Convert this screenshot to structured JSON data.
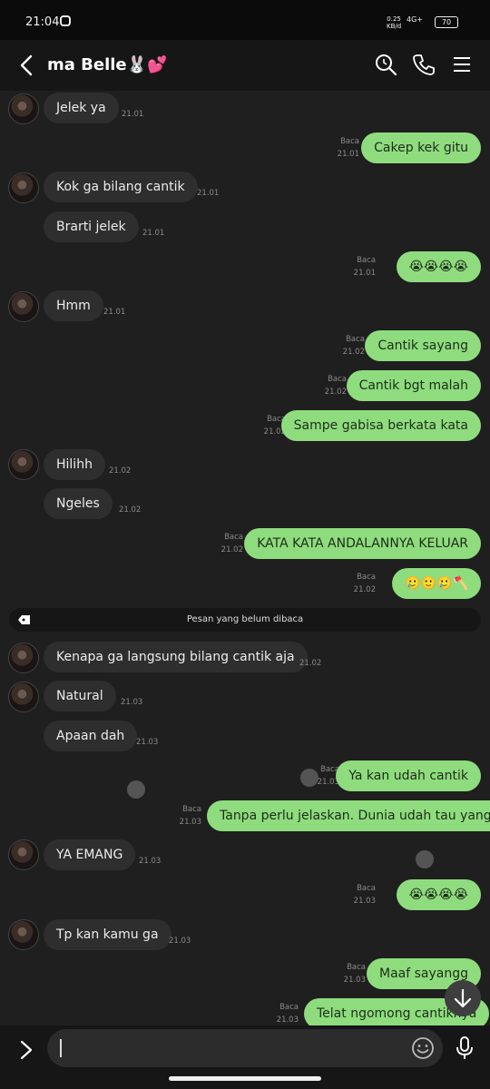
{
  "status_bar": {
    "time": "21:04",
    "net_speed": "0.25\nKB/d",
    "network": "4G+",
    "battery": "70"
  },
  "header": {
    "title": "ma Belle🐰💕",
    "back_icon": "chevron-left-icon",
    "search_icon": "search-icon",
    "call_icon": "phone-icon",
    "menu_icon": "menu-icon"
  },
  "messages": [
    {
      "dir": "in",
      "avatar": true,
      "text": "Jelek ya",
      "time": "21.01"
    },
    {
      "dir": "out",
      "text": "Cakep kek gitu",
      "read": "Baca",
      "time": "21.01"
    },
    {
      "dir": "in",
      "avatar": true,
      "text": "Kok ga bilang cantik",
      "time": "21.01"
    },
    {
      "dir": "in",
      "text": "Brarti jelek",
      "time": "21.01"
    },
    {
      "dir": "out",
      "text": "😭😭😭😭",
      "read": "Baca",
      "time": "21.01"
    },
    {
      "dir": "in",
      "avatar": true,
      "text": "Hmm",
      "time": "21.01"
    },
    {
      "dir": "out",
      "text": "Cantik sayang",
      "read": "Baca",
      "time": "21.02"
    },
    {
      "dir": "out",
      "text": "Cantik bgt malah",
      "read": "Baca",
      "time": "21.02"
    },
    {
      "dir": "out",
      "text": "Sampe gabisa berkata kata",
      "read": "Baca",
      "time": "21.02"
    },
    {
      "dir": "in",
      "avatar": true,
      "text": "Hilihh",
      "time": "21.02"
    },
    {
      "dir": "in",
      "text": "Ngeles",
      "time": "21.02"
    },
    {
      "dir": "out",
      "text": "KATA KATA ANDALANNYA KELUAR",
      "read": "Baca",
      "time": "21.02"
    },
    {
      "dir": "out",
      "text": "🥲🙂🥲🪓",
      "read": "Baca",
      "time": "21.02"
    },
    {
      "dir": "in",
      "avatar": true,
      "text": "Kenapa ga langsung bilang cantik aja",
      "time": "21.02"
    },
    {
      "dir": "in",
      "avatar": true,
      "text": "Natural",
      "time": "21.03"
    },
    {
      "dir": "in",
      "text": "Apaan dah",
      "time": "21.03"
    },
    {
      "dir": "out",
      "text": "Ya kan udah cantik",
      "read": "Baca",
      "time": "21.03"
    },
    {
      "dir": "out",
      "text": "Tanpa perlu jelaskan. Dunia udah tau yang",
      "read": "Baca",
      "time": "21.03"
    },
    {
      "dir": "in",
      "avatar": true,
      "text": "YA EMANG",
      "time": "21.03"
    },
    {
      "dir": "out",
      "text": "😭😭😭😭",
      "read": "Baca",
      "time": "21.03"
    },
    {
      "dir": "in",
      "avatar": true,
      "text": "Tp kan kamu ga",
      "time": "21.03"
    },
    {
      "dir": "out",
      "text": "Maaf sayangg",
      "read": "Baca",
      "time": "21.03"
    },
    {
      "dir": "out",
      "text": "Telat ngomong cantiknya",
      "read": "Baca",
      "time": "21.03"
    }
  ],
  "unread_divider": "Pesan yang belum dibaca",
  "input": {
    "placeholder": "",
    "emoji_icon": "smile-icon",
    "mic_icon": "mic-icon",
    "expand_icon": "chevron-right-icon"
  },
  "scroll_down_icon": "arrow-down-icon",
  "colors": {
    "outgoing": "#8fdc7e",
    "incoming": "#2e2e2e",
    "background": "#1f1f1f"
  }
}
